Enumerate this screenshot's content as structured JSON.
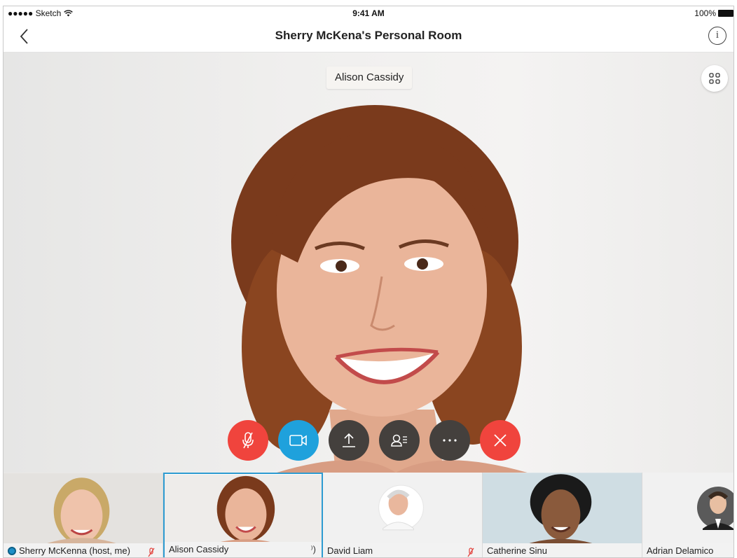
{
  "status_bar": {
    "carrier": "●●●●● Sketch",
    "time": "9:41 AM",
    "battery": "100%"
  },
  "nav": {
    "title": "Sherry McKena's Personal Room",
    "info_glyph": "i"
  },
  "main_video": {
    "active_speaker": "Alison Cassidy"
  },
  "controls": [
    {
      "name": "mute-button",
      "icon": "mic-off-icon",
      "color": "#f0443d"
    },
    {
      "name": "video-button",
      "icon": "video-camera-icon",
      "color": "#1fa1dc"
    },
    {
      "name": "share-button",
      "icon": "upload-icon",
      "color": "#44403d"
    },
    {
      "name": "participants-button",
      "icon": "participants-list-icon",
      "color": "#44403d"
    },
    {
      "name": "more-button",
      "icon": "more-dots-icon",
      "color": "#44403d"
    },
    {
      "name": "leave-button",
      "icon": "close-icon",
      "color": "#f0443d"
    }
  ],
  "participants": [
    {
      "name": "Sherry McKenna (host, me)",
      "muted": true,
      "host": true
    },
    {
      "name": "Alison Cassidy",
      "muted": false,
      "speaking": true,
      "active": true
    },
    {
      "name": "David Liam",
      "muted": true
    },
    {
      "name": "Catherine Sinu",
      "muted": false
    },
    {
      "name": "Adrian Delamico",
      "muted": false
    }
  ]
}
